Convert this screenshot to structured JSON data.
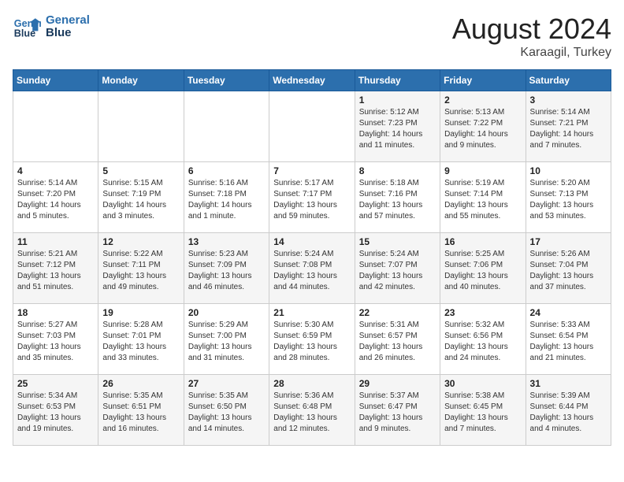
{
  "header": {
    "logo_line1": "General",
    "logo_line2": "Blue",
    "month_year": "August 2024",
    "location": "Karaagil, Turkey"
  },
  "days_of_week": [
    "Sunday",
    "Monday",
    "Tuesday",
    "Wednesday",
    "Thursday",
    "Friday",
    "Saturday"
  ],
  "weeks": [
    [
      {
        "day": "",
        "sunrise": "",
        "sunset": "",
        "daylight": ""
      },
      {
        "day": "",
        "sunrise": "",
        "sunset": "",
        "daylight": ""
      },
      {
        "day": "",
        "sunrise": "",
        "sunset": "",
        "daylight": ""
      },
      {
        "day": "",
        "sunrise": "",
        "sunset": "",
        "daylight": ""
      },
      {
        "day": "1",
        "sunrise": "Sunrise: 5:12 AM",
        "sunset": "Sunset: 7:23 PM",
        "daylight": "Daylight: 14 hours and 11 minutes."
      },
      {
        "day": "2",
        "sunrise": "Sunrise: 5:13 AM",
        "sunset": "Sunset: 7:22 PM",
        "daylight": "Daylight: 14 hours and 9 minutes."
      },
      {
        "day": "3",
        "sunrise": "Sunrise: 5:14 AM",
        "sunset": "Sunset: 7:21 PM",
        "daylight": "Daylight: 14 hours and 7 minutes."
      }
    ],
    [
      {
        "day": "4",
        "sunrise": "Sunrise: 5:14 AM",
        "sunset": "Sunset: 7:20 PM",
        "daylight": "Daylight: 14 hours and 5 minutes."
      },
      {
        "day": "5",
        "sunrise": "Sunrise: 5:15 AM",
        "sunset": "Sunset: 7:19 PM",
        "daylight": "Daylight: 14 hours and 3 minutes."
      },
      {
        "day": "6",
        "sunrise": "Sunrise: 5:16 AM",
        "sunset": "Sunset: 7:18 PM",
        "daylight": "Daylight: 14 hours and 1 minute."
      },
      {
        "day": "7",
        "sunrise": "Sunrise: 5:17 AM",
        "sunset": "Sunset: 7:17 PM",
        "daylight": "Daylight: 13 hours and 59 minutes."
      },
      {
        "day": "8",
        "sunrise": "Sunrise: 5:18 AM",
        "sunset": "Sunset: 7:16 PM",
        "daylight": "Daylight: 13 hours and 57 minutes."
      },
      {
        "day": "9",
        "sunrise": "Sunrise: 5:19 AM",
        "sunset": "Sunset: 7:14 PM",
        "daylight": "Daylight: 13 hours and 55 minutes."
      },
      {
        "day": "10",
        "sunrise": "Sunrise: 5:20 AM",
        "sunset": "Sunset: 7:13 PM",
        "daylight": "Daylight: 13 hours and 53 minutes."
      }
    ],
    [
      {
        "day": "11",
        "sunrise": "Sunrise: 5:21 AM",
        "sunset": "Sunset: 7:12 PM",
        "daylight": "Daylight: 13 hours and 51 minutes."
      },
      {
        "day": "12",
        "sunrise": "Sunrise: 5:22 AM",
        "sunset": "Sunset: 7:11 PM",
        "daylight": "Daylight: 13 hours and 49 minutes."
      },
      {
        "day": "13",
        "sunrise": "Sunrise: 5:23 AM",
        "sunset": "Sunset: 7:09 PM",
        "daylight": "Daylight: 13 hours and 46 minutes."
      },
      {
        "day": "14",
        "sunrise": "Sunrise: 5:24 AM",
        "sunset": "Sunset: 7:08 PM",
        "daylight": "Daylight: 13 hours and 44 minutes."
      },
      {
        "day": "15",
        "sunrise": "Sunrise: 5:24 AM",
        "sunset": "Sunset: 7:07 PM",
        "daylight": "Daylight: 13 hours and 42 minutes."
      },
      {
        "day": "16",
        "sunrise": "Sunrise: 5:25 AM",
        "sunset": "Sunset: 7:06 PM",
        "daylight": "Daylight: 13 hours and 40 minutes."
      },
      {
        "day": "17",
        "sunrise": "Sunrise: 5:26 AM",
        "sunset": "Sunset: 7:04 PM",
        "daylight": "Daylight: 13 hours and 37 minutes."
      }
    ],
    [
      {
        "day": "18",
        "sunrise": "Sunrise: 5:27 AM",
        "sunset": "Sunset: 7:03 PM",
        "daylight": "Daylight: 13 hours and 35 minutes."
      },
      {
        "day": "19",
        "sunrise": "Sunrise: 5:28 AM",
        "sunset": "Sunset: 7:01 PM",
        "daylight": "Daylight: 13 hours and 33 minutes."
      },
      {
        "day": "20",
        "sunrise": "Sunrise: 5:29 AM",
        "sunset": "Sunset: 7:00 PM",
        "daylight": "Daylight: 13 hours and 31 minutes."
      },
      {
        "day": "21",
        "sunrise": "Sunrise: 5:30 AM",
        "sunset": "Sunset: 6:59 PM",
        "daylight": "Daylight: 13 hours and 28 minutes."
      },
      {
        "day": "22",
        "sunrise": "Sunrise: 5:31 AM",
        "sunset": "Sunset: 6:57 PM",
        "daylight": "Daylight: 13 hours and 26 minutes."
      },
      {
        "day": "23",
        "sunrise": "Sunrise: 5:32 AM",
        "sunset": "Sunset: 6:56 PM",
        "daylight": "Daylight: 13 hours and 24 minutes."
      },
      {
        "day": "24",
        "sunrise": "Sunrise: 5:33 AM",
        "sunset": "Sunset: 6:54 PM",
        "daylight": "Daylight: 13 hours and 21 minutes."
      }
    ],
    [
      {
        "day": "25",
        "sunrise": "Sunrise: 5:34 AM",
        "sunset": "Sunset: 6:53 PM",
        "daylight": "Daylight: 13 hours and 19 minutes."
      },
      {
        "day": "26",
        "sunrise": "Sunrise: 5:35 AM",
        "sunset": "Sunset: 6:51 PM",
        "daylight": "Daylight: 13 hours and 16 minutes."
      },
      {
        "day": "27",
        "sunrise": "Sunrise: 5:35 AM",
        "sunset": "Sunset: 6:50 PM",
        "daylight": "Daylight: 13 hours and 14 minutes."
      },
      {
        "day": "28",
        "sunrise": "Sunrise: 5:36 AM",
        "sunset": "Sunset: 6:48 PM",
        "daylight": "Daylight: 13 hours and 12 minutes."
      },
      {
        "day": "29",
        "sunrise": "Sunrise: 5:37 AM",
        "sunset": "Sunset: 6:47 PM",
        "daylight": "Daylight: 13 hours and 9 minutes."
      },
      {
        "day": "30",
        "sunrise": "Sunrise: 5:38 AM",
        "sunset": "Sunset: 6:45 PM",
        "daylight": "Daylight: 13 hours and 7 minutes."
      },
      {
        "day": "31",
        "sunrise": "Sunrise: 5:39 AM",
        "sunset": "Sunset: 6:44 PM",
        "daylight": "Daylight: 13 hours and 4 minutes."
      }
    ]
  ]
}
